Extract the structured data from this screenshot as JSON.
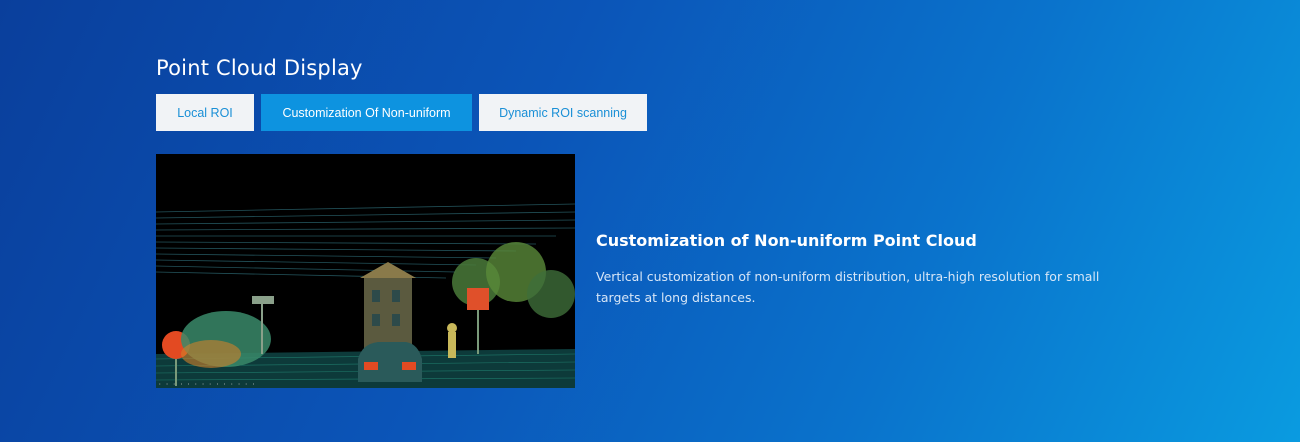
{
  "section": {
    "title": "Point Cloud Display"
  },
  "tabs": [
    {
      "label": "Local ROI",
      "active": false
    },
    {
      "label": "Customization Of Non-uniform",
      "active": true
    },
    {
      "label": "Dynamic ROI scanning",
      "active": false
    }
  ],
  "detail": {
    "title": "Customization of Non-uniform Point Cloud",
    "description": "Vertical customization of non-uniform distribution, ultra-high resolution for small targets at long distances."
  },
  "colors": {
    "background_start": "#0a3f9c",
    "background_end": "#0a9be0",
    "tab_active_bg": "#0d93e0",
    "tab_inactive_bg": "#f1f3f6",
    "tab_inactive_text": "#1a8fd6"
  }
}
